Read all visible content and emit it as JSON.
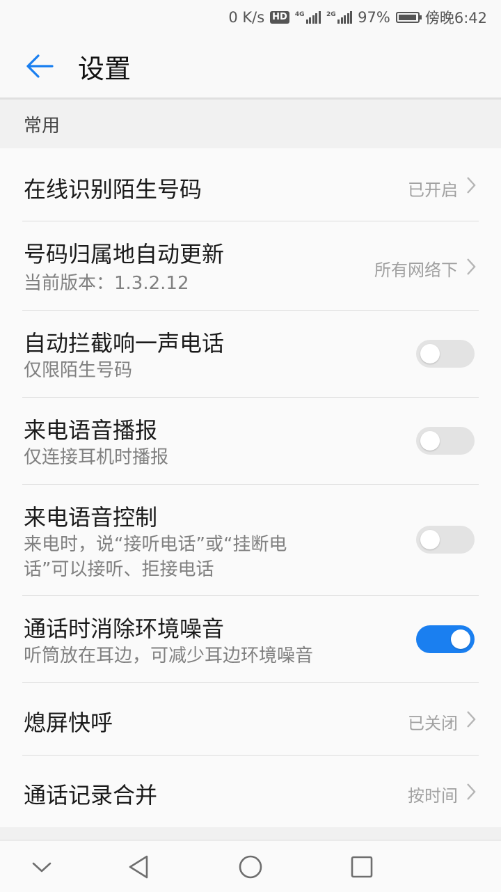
{
  "status_bar": {
    "net_speed": "0 K/s",
    "hd_badge": "HD",
    "sim1_tag": "4G",
    "sim2_tag": "2G",
    "battery_percent": "97%",
    "battery_level": 0.97,
    "time": "傍晚6:42"
  },
  "app_bar": {
    "title": "设置",
    "back_icon": "arrow-left-icon"
  },
  "section": {
    "title": "常用"
  },
  "settings": [
    {
      "title": "在线识别陌生号码",
      "value": "已开启",
      "type": "link"
    },
    {
      "title": "号码归属地自动更新",
      "subtitle": "当前版本：1.3.2.12",
      "value": "所有网络下",
      "type": "link"
    },
    {
      "title": "自动拦截响一声电话",
      "subtitle": "仅限陌生号码",
      "type": "toggle",
      "on": false
    },
    {
      "title": "来电语音播报",
      "subtitle": "仅连接耳机时播报",
      "type": "toggle",
      "on": false
    },
    {
      "title": "来电语音控制",
      "subtitle_line1": "来电时，说“接听电话”或“挂断电",
      "subtitle_line2": "话”可以接听、拒接电话",
      "type": "toggle",
      "on": false
    },
    {
      "title": "通话时消除环境噪音",
      "subtitle": "听筒放在耳边，可减少耳边环境噪音",
      "type": "toggle",
      "on": true
    },
    {
      "title": "熄屏快呼",
      "value": "已关闭",
      "type": "link"
    },
    {
      "title": "通话记录合并",
      "value": "按时间",
      "type": "link"
    }
  ],
  "colors": {
    "accent": "#1a7ff0",
    "toggle_off": "#e3e3e3",
    "back_arrow": "#1a7ff0"
  },
  "nav_bar": {
    "icons": [
      "chevron-down-icon",
      "back-triangle-icon",
      "home-circle-icon",
      "recents-square-icon"
    ]
  }
}
